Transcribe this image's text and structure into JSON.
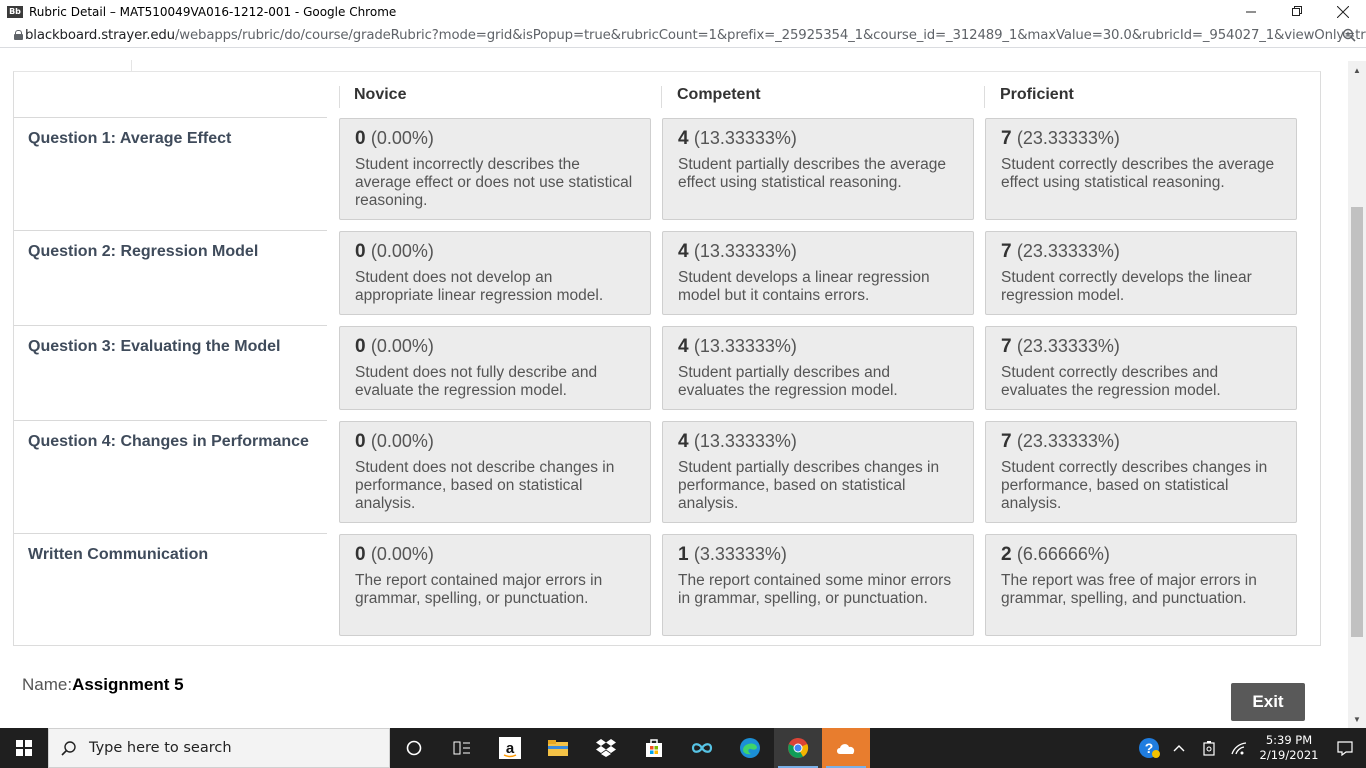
{
  "window": {
    "title": "Rubric Detail – MAT510049VA016-1212-001 - Google Chrome",
    "url_host": "blackboard.strayer.edu",
    "url_path": "/webapps/rubric/do/course/gradeRubric?mode=grid&isPopup=true&rubricCount=1&prefix=_25925354_1&course_id=_312489_1&maxValue=30.0&rubricId=_954027_1&viewOnly=tru..."
  },
  "rubric": {
    "columns": [
      "Novice",
      "Competent",
      "Proficient"
    ],
    "rows": [
      {
        "label": "Question 1: Average Effect",
        "cells": [
          {
            "score": "0",
            "percent": "(0.00%)",
            "desc": "Student incorrectly describes the average effect or does not use statistical reasoning."
          },
          {
            "score": "4",
            "percent": "(13.33333%)",
            "desc": "Student partially describes the average effect using statistical reasoning."
          },
          {
            "score": "7",
            "percent": "(23.33333%)",
            "desc": "Student correctly describes the average effect using statistical reasoning."
          }
        ]
      },
      {
        "label": "Question 2: Regression Model",
        "cells": [
          {
            "score": "0",
            "percent": "(0.00%)",
            "desc": "Student does not develop an appropriate linear regression model."
          },
          {
            "score": "4",
            "percent": "(13.33333%)",
            "desc": "Student develops a linear regression model but it contains errors."
          },
          {
            "score": "7",
            "percent": "(23.33333%)",
            "desc": "Student correctly develops the linear regression model."
          }
        ]
      },
      {
        "label": "Question 3: Evaluating the Model",
        "cells": [
          {
            "score": "0",
            "percent": "(0.00%)",
            "desc": "Student does not fully describe and evaluate the regression model."
          },
          {
            "score": "4",
            "percent": "(13.33333%)",
            "desc": "Student partially describes and evaluates the regression model."
          },
          {
            "score": "7",
            "percent": "(23.33333%)",
            "desc": "Student correctly describes and evaluates the regression model."
          }
        ]
      },
      {
        "label": "Question 4: Changes in Performance",
        "cells": [
          {
            "score": "0",
            "percent": "(0.00%)",
            "desc": "Student does not describe changes in performance, based on statistical analysis."
          },
          {
            "score": "4",
            "percent": "(13.33333%)",
            "desc": "Student partially describes changes in performance, based on statistical analysis."
          },
          {
            "score": "7",
            "percent": "(23.33333%)",
            "desc": "Student correctly describes changes in performance, based on statistical analysis."
          }
        ]
      },
      {
        "label": "Written Communication",
        "cells": [
          {
            "score": "0",
            "percent": "(0.00%)",
            "desc": "The report contained major errors in grammar, spelling, or punctuation."
          },
          {
            "score": "1",
            "percent": "(3.33333%)",
            "desc": "The report contained some minor errors in grammar, spelling, or punctuation."
          },
          {
            "score": "2",
            "percent": "(6.66666%)",
            "desc": "The report was free of major errors in grammar, spelling, and punctuation."
          }
        ]
      }
    ]
  },
  "footer": {
    "name_label": "Name:",
    "name_value": "Assignment 5",
    "exit_label": "Exit"
  },
  "taskbar": {
    "search_placeholder": "Type here to search",
    "time": "5:39 PM",
    "date": "2/19/2021"
  },
  "colors": {
    "cell_bg": "#ececec",
    "exit_bg": "#595959",
    "taskbar_bg": "#1f1f1f"
  }
}
